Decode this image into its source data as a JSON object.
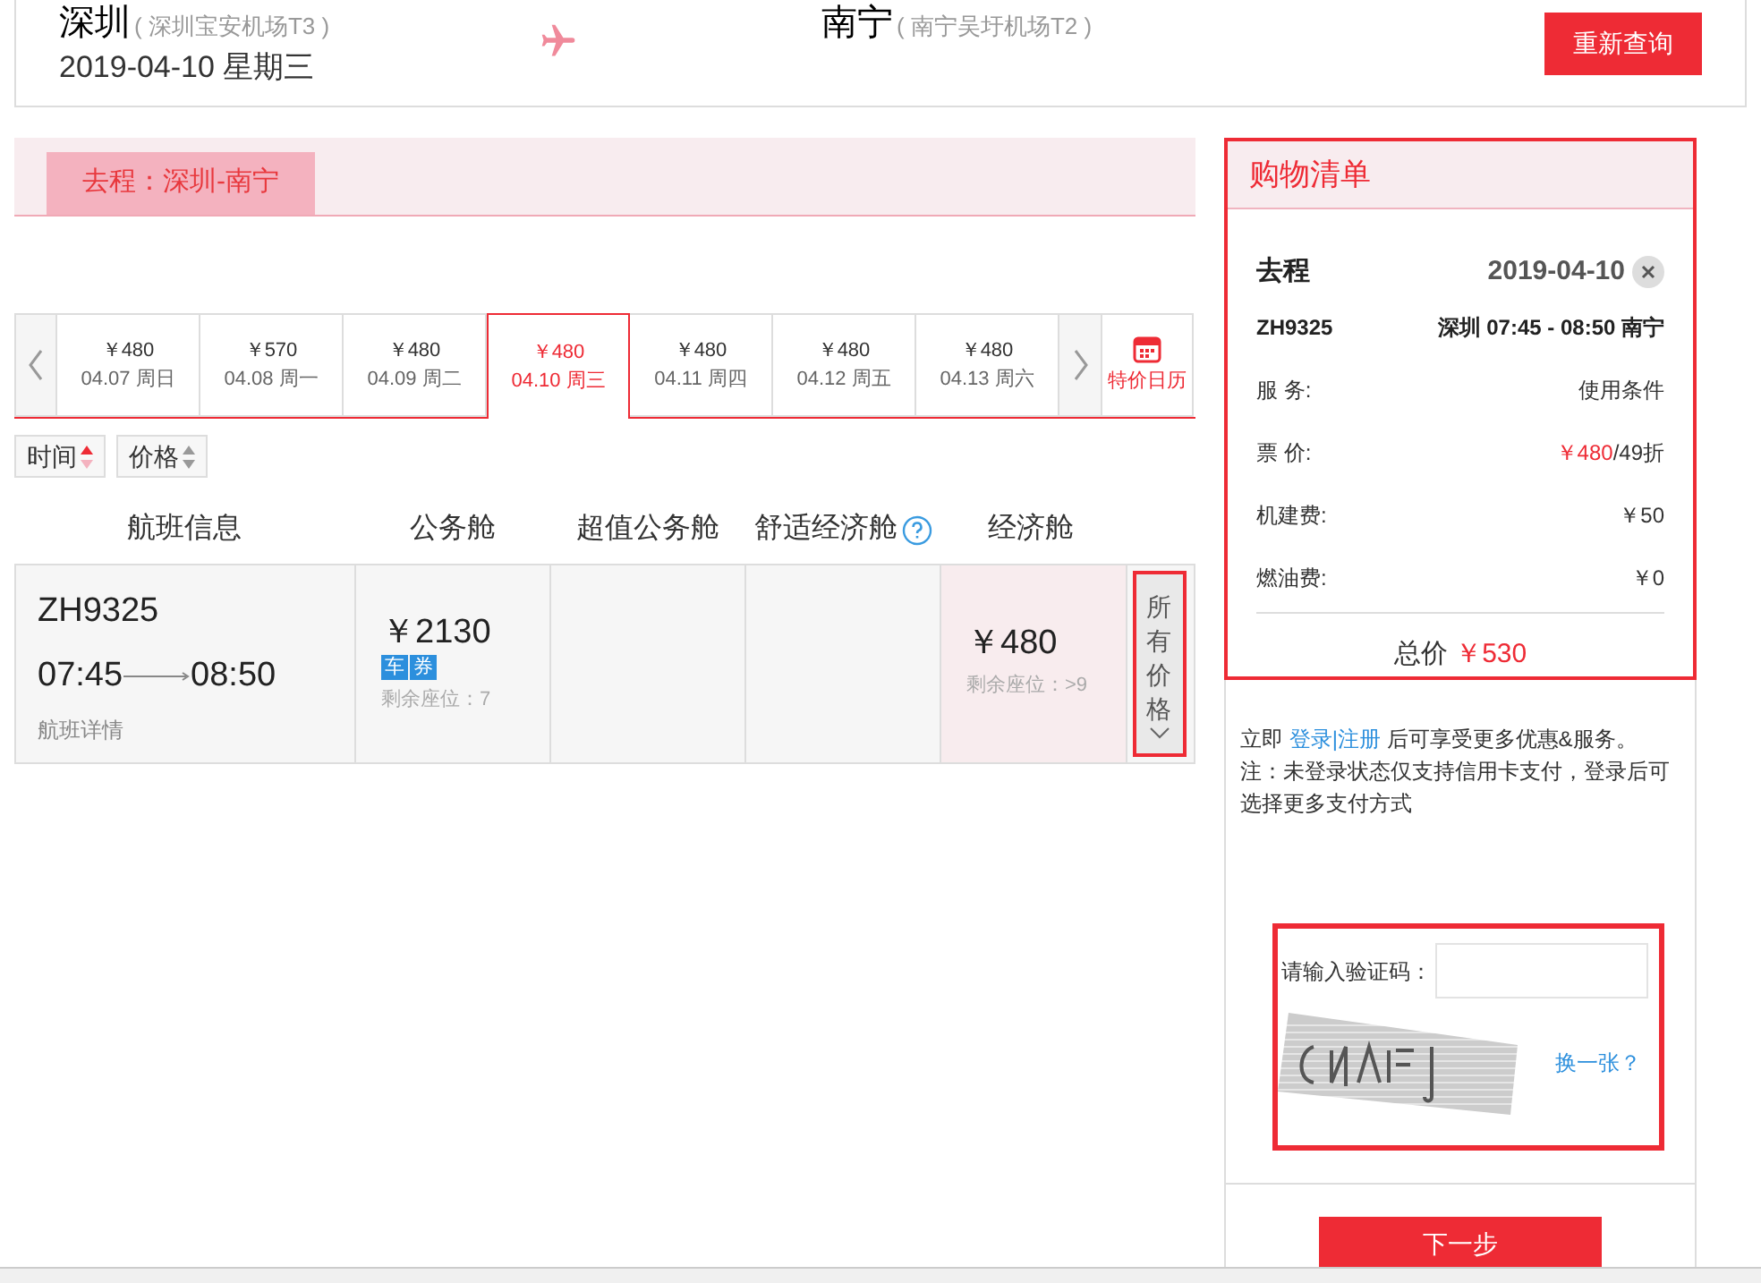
{
  "header": {
    "from_city": "深圳",
    "from_airport": "( 深圳宝安机场T3 )",
    "date": "2019-04-10 星期三",
    "to_city": "南宁",
    "to_airport": "( 南宁吴圩机场T2 )",
    "search_again": "重新查询"
  },
  "trip_tabs": [
    {
      "label": "去程：深圳-南宁",
      "selected": true
    }
  ],
  "date_strip": {
    "days": [
      {
        "price": "￥480",
        "date": "04.07 周日",
        "selected": false
      },
      {
        "price": "￥570",
        "date": "04.08 周一",
        "selected": false
      },
      {
        "price": "￥480",
        "date": "04.09 周二",
        "selected": false
      },
      {
        "price": "￥480",
        "date": "04.10 周三",
        "selected": true
      },
      {
        "price": "￥480",
        "date": "04.11 周四",
        "selected": false
      },
      {
        "price": "￥480",
        "date": "04.12 周五",
        "selected": false
      },
      {
        "price": "￥480",
        "date": "04.13 周六",
        "selected": false
      }
    ],
    "calendar_label": "特价日历"
  },
  "sort": [
    {
      "label": "时间",
      "selected": true
    },
    {
      "label": "价格",
      "selected": false
    }
  ],
  "columns": [
    {
      "kind": "plain",
      "label": "航班信息"
    },
    {
      "kind": "plain",
      "label": "公务舱"
    },
    {
      "kind": "plain",
      "label": "超值公务舱"
    },
    {
      "kind": "help",
      "label": "舒适经济舱"
    },
    {
      "kind": "plain",
      "label": "经济舱"
    }
  ],
  "flight": {
    "number": "ZH9325",
    "depart": "07:45",
    "arrive": "08:50",
    "details_link": "航班详情",
    "fares": [
      {
        "kind": "fare",
        "price": "￥2130",
        "tags": [
          "车",
          "券"
        ],
        "seats": "剩余座位：7",
        "highlighted": false
      },
      {
        "kind": "empty"
      },
      {
        "kind": "empty"
      },
      {
        "kind": "fare",
        "price": "￥480",
        "seats": "剩余座位：>9",
        "highlighted": true
      }
    ],
    "all_prices": "所有价格"
  },
  "cart": {
    "title": "购物清单",
    "trip": "去程",
    "date": "2019-04-10",
    "flight": "ZH9325",
    "route": "深圳 07:45 - 08:50 南宁",
    "rows": [
      {
        "kind": "plain",
        "label": "服 务:",
        "value": "使用条件"
      },
      {
        "kind": "fare",
        "label": "票 价:",
        "value": "￥480",
        "suffix": "/49折"
      },
      {
        "kind": "plain",
        "label": "机建费:",
        "value": "￥50"
      },
      {
        "kind": "plain",
        "label": "燃油费:",
        "value": "￥0"
      }
    ],
    "total_label": "总价",
    "total": "￥530"
  },
  "login": {
    "prefix": "立即",
    "links": [
      "登录",
      "注册"
    ],
    "separator": "|",
    "suffix": "后可享受更多优惠&服务。",
    "note": "注：未登录状态仅支持信用卡支付，登录后可选择更多支付方式"
  },
  "captcha": {
    "label": "请输入验证码：",
    "refresh": "换一张？"
  },
  "next_button": "下一步"
}
